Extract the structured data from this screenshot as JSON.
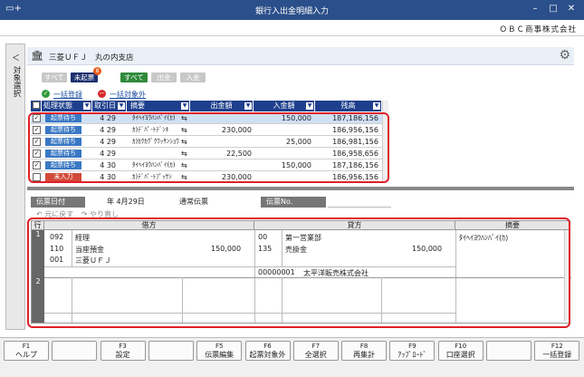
{
  "window": {
    "title": "銀行入出金明細入力",
    "company": "ＯＢＣ商事株式会社"
  },
  "sidebar": {
    "arrow": "＜",
    "label": "対象選択"
  },
  "bank": {
    "name": "三菱ＵＦＪ　丸の内支店"
  },
  "filters": {
    "all1": "すべて",
    "unprocessed": "未起票",
    "badge": "8",
    "all2": "すべて",
    "out": "出金",
    "in": "入金"
  },
  "links": {
    "bulk_register": "一括登録",
    "bulk_exclude": "一括対象外"
  },
  "grid": {
    "headers": [
      "処理状態",
      "取引日",
      "摘要",
      "出金額",
      "入金額",
      "残高"
    ],
    "rows": [
      {
        "checked": true,
        "status": "起票待ち",
        "date": "4 29",
        "memo": "ﾀｲﾍｲﾖｳﾊﾝﾊﾞｲ(ｶ)",
        "out": "",
        "in": "150,000",
        "bal": "187,186,156",
        "red": false,
        "selected": true
      },
      {
        "checked": true,
        "status": "起票待ち",
        "date": "4 29",
        "memo": "ｶ)ﾃﾞﾊﾟ-ﾄﾃﾞﾝｷ",
        "out": "230,000",
        "in": "",
        "bal": "186,956,156",
        "red": false,
        "selected": false
      },
      {
        "checked": true,
        "status": "起票待ち",
        "date": "4 29",
        "memo": "ｶ)ｶｸｶｸﾞｸﾜｯｻﾝｼｮｳｶｲ",
        "out": "",
        "in": "25,000",
        "bal": "186,981,156",
        "red": false,
        "selected": false
      },
      {
        "checked": true,
        "status": "起票待ち",
        "date": "4 29",
        "memo": "",
        "out": "22,500",
        "in": "",
        "bal": "186,958,656",
        "red": false,
        "selected": false
      },
      {
        "checked": true,
        "status": "起票待ち",
        "date": "4 30",
        "memo": "ﾀｲﾍｲﾖｳﾊﾝﾊﾞｲ(ｶ)",
        "out": "",
        "in": "150,000",
        "bal": "187,186,156",
        "red": false,
        "selected": false
      },
      {
        "checked": false,
        "status": "未入力",
        "date": "4 30",
        "memo": "ｶ)ﾃﾞﾊﾟ-ﾄﾌﾟｯｻﾝ",
        "out": "230,000",
        "in": "",
        "bal": "186,956,156",
        "red": true,
        "selected": false
      }
    ]
  },
  "voucher": {
    "date_label": "伝票日付",
    "date_value": "年  4月29日",
    "type": "通常伝票",
    "no_label": "伝票No.",
    "undo": "元に戻す",
    "redo": "やり直し"
  },
  "journal": {
    "headers": {
      "row": "行",
      "debit": "借方",
      "credit": "貸方",
      "summary": "摘要"
    },
    "row1": {
      "num": "1",
      "d_dept_code": "092",
      "d_dept": "経理",
      "d_acct_code": "110",
      "d_acct": "当座預金",
      "d_amount": "150,000",
      "d_sub_code": "001",
      "d_sub": "三菱ＵＦＪ",
      "c_dept_code": "00",
      "c_dept": "第一営業部",
      "c_acct_code": "135",
      "c_acct": "売掛金",
      "c_amount": "150,000",
      "c_partner_code": "00000001",
      "c_partner": "太平洋販売株式会社",
      "summary": "ﾀｲﾍｲﾖｳﾊﾝﾊﾞｲ(ｶ)"
    },
    "row2": {
      "num": "2"
    }
  },
  "fkeys": [
    {
      "n": "F1",
      "l": "ヘルプ"
    },
    {
      "n": "",
      "l": ""
    },
    {
      "n": "F3",
      "l": "設定"
    },
    {
      "n": "",
      "l": ""
    },
    {
      "n": "F5",
      "l": "伝票編集"
    },
    {
      "n": "F6",
      "l": "起票対象外"
    },
    {
      "n": "F7",
      "l": "全選択"
    },
    {
      "n": "F8",
      "l": "再集計"
    },
    {
      "n": "F9",
      "l": "ｱｯﾌﾟﾛｰﾄﾞ"
    },
    {
      "n": "F10",
      "l": "口座選択"
    },
    {
      "n": "",
      "l": ""
    },
    {
      "n": "F12",
      "l": "一括登録"
    }
  ]
}
